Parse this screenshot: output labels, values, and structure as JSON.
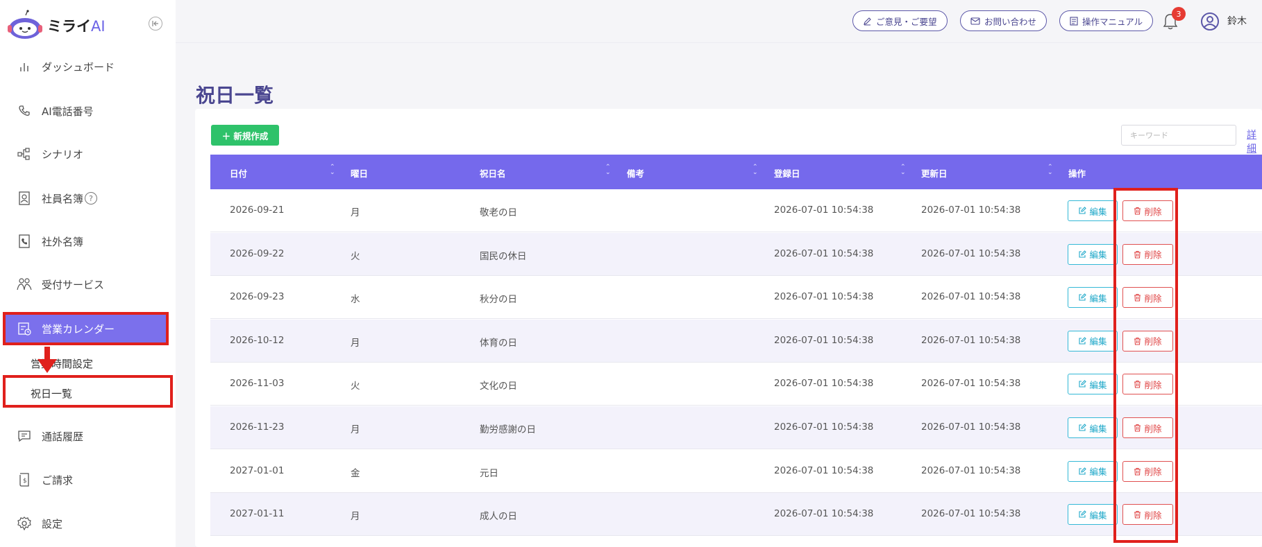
{
  "logo": {
    "text": "ミライ",
    "ai": "AI"
  },
  "sidebar": {
    "items": [
      {
        "label": "ダッシュボード",
        "icon": "bar-chart-icon"
      },
      {
        "label": "AI電話番号",
        "icon": "phone-icon"
      },
      {
        "label": "シナリオ",
        "icon": "flow-icon"
      },
      {
        "label": "社員名簿",
        "icon": "contact-book-icon"
      },
      {
        "label": "社外名簿",
        "icon": "phone-book-icon"
      },
      {
        "label": "受付サービス",
        "icon": "people-icon"
      },
      {
        "label": "営業カレンダー",
        "icon": "calendar-clock-icon"
      },
      {
        "label": "通話履歴",
        "icon": "message-icon"
      },
      {
        "label": "ご請求",
        "icon": "bill-icon"
      },
      {
        "label": "設定",
        "icon": "gear-icon"
      }
    ],
    "help_mark": "?",
    "sub_items": [
      {
        "label": "営業時間設定"
      },
      {
        "label": "祝日一覧"
      }
    ]
  },
  "header": {
    "feedback": "ご意見・ご要望",
    "contact": "お問い合わせ",
    "manual": "操作マニュアル",
    "notification_count": "3",
    "user_name": "鈴木"
  },
  "page": {
    "title": "祝日一覧",
    "new_button": "＋ 新規作成",
    "keyword_placeholder": "キーワード",
    "detail_link": "詳細"
  },
  "table": {
    "headers": {
      "date": "日付",
      "weekday": "曜日",
      "name": "祝日名",
      "note": "備考",
      "created": "登録日",
      "updated": "更新日",
      "actions": "操作"
    },
    "edit_label": "編集",
    "delete_label": "削除",
    "rows": [
      {
        "date": "2026-09-21",
        "weekday": "月",
        "name": "敬老の日",
        "note": "",
        "created": "2026-07-01 10:54:38",
        "updated": "2026-07-01 10:54:38"
      },
      {
        "date": "2026-09-22",
        "weekday": "火",
        "name": "国民の休日",
        "note": "",
        "created": "2026-07-01 10:54:38",
        "updated": "2026-07-01 10:54:38"
      },
      {
        "date": "2026-09-23",
        "weekday": "水",
        "name": "秋分の日",
        "note": "",
        "created": "2026-07-01 10:54:38",
        "updated": "2026-07-01 10:54:38"
      },
      {
        "date": "2026-10-12",
        "weekday": "月",
        "name": "体育の日",
        "note": "",
        "created": "2026-07-01 10:54:38",
        "updated": "2026-07-01 10:54:38"
      },
      {
        "date": "2026-11-03",
        "weekday": "火",
        "name": "文化の日",
        "note": "",
        "created": "2026-07-01 10:54:38",
        "updated": "2026-07-01 10:54:38"
      },
      {
        "date": "2026-11-23",
        "weekday": "月",
        "name": "勤労感謝の日",
        "note": "",
        "created": "2026-07-01 10:54:38",
        "updated": "2026-07-01 10:54:38"
      },
      {
        "date": "2027-01-01",
        "weekday": "金",
        "name": "元日",
        "note": "",
        "created": "2026-07-01 10:54:38",
        "updated": "2026-07-01 10:54:38"
      },
      {
        "date": "2027-01-11",
        "weekday": "月",
        "name": "成人の日",
        "note": "",
        "created": "2026-07-01 10:54:38",
        "updated": "2026-07-01 10:54:38"
      }
    ]
  },
  "colors": {
    "accent": "#7569ec",
    "annotation": "#e0201c",
    "new_button": "#2ec26a",
    "edit": "#1fa8c9",
    "delete": "#e04545"
  }
}
